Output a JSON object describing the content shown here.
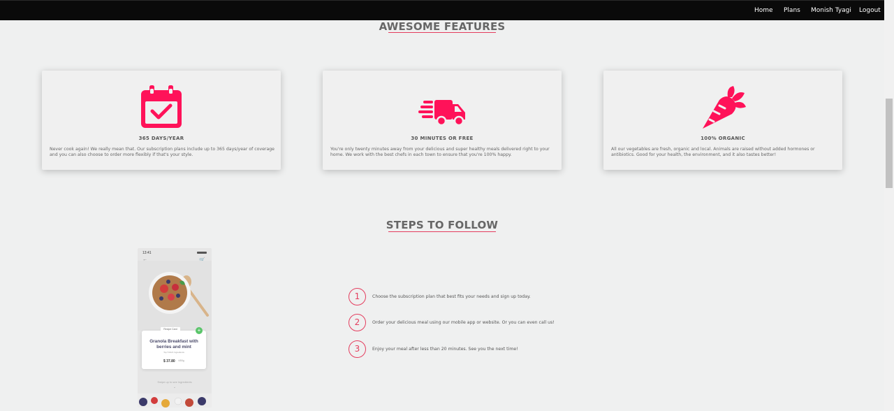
{
  "nav": {
    "items": [
      "Home",
      "Plans",
      "Monish Tyagi",
      "Logout"
    ]
  },
  "features": {
    "title": "AWESOME FEATURES",
    "cards": [
      {
        "icon": "calendar-check-icon",
        "title": "365 DAYS/YEAR",
        "text": "Never cook again! We really mean that. Our subscription plans include up to 365 days/year of coverage and you can also choose to order more flexibly if that's your style."
      },
      {
        "icon": "delivery-truck-icon",
        "title": "30 MINUTES OR FREE",
        "text": "You're only twenty minutes away from your delicious and super healthy meals delivered right to your home. We work with the best chefs in each town to ensure that you're 100% happy."
      },
      {
        "icon": "carrot-icon",
        "title": "100% ORGANIC",
        "text": "All our vegetables are fresh, organic and local. Animals are raised without added hormones or antibiotics. Good for your health, the environment, and it also tastes better!"
      }
    ]
  },
  "steps": {
    "title": "STEPS TO FOLLOW",
    "items": [
      {
        "num": "1",
        "text": "Choose the subscription plan that best fits your needs and sign up today."
      },
      {
        "num": "2",
        "text": "Order your delicious meal using our mobile app or website. Or you can even call us!"
      },
      {
        "num": "3",
        "text": "Enjoy your meal after less than 20 minutes. See you the next time!"
      }
    ]
  },
  "phone": {
    "time": "13:41",
    "tag": "Recipe Card",
    "recipe_name": "Granola Breakfast with berries and mint",
    "recipe_sub": "Top 5 Rich Ingredients",
    "price": "$ 37.80",
    "price_unit": "/450g",
    "swipe_text": "Swipe up to see ingredients",
    "arrow": "⌄"
  },
  "colors": {
    "accent": "#e43d5e",
    "icon": "#ff1259",
    "nav_bg": "#0a0a0a",
    "page_bg": "#eff0f0"
  }
}
